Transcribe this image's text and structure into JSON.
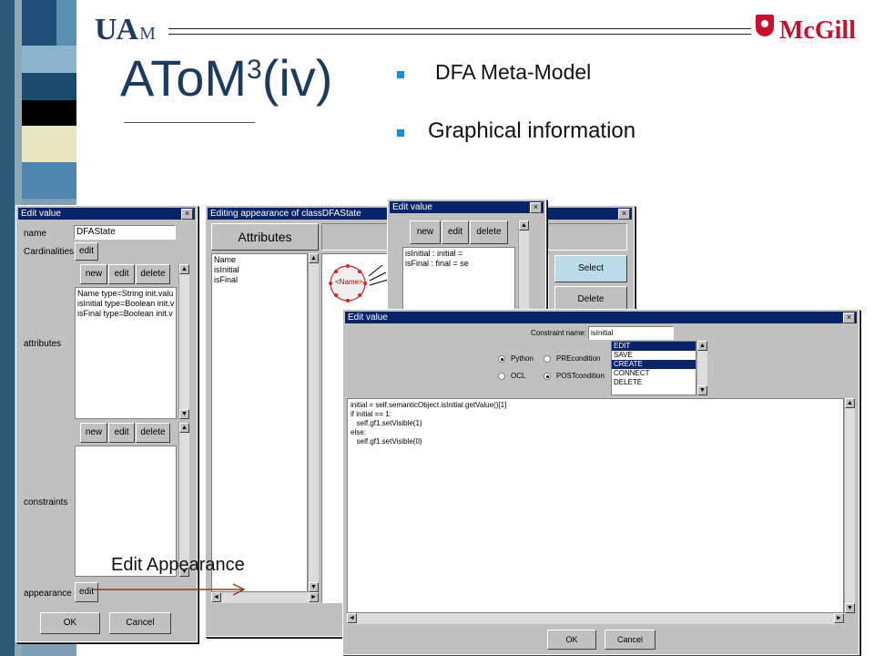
{
  "header": {
    "logo_left": "UA",
    "logo_left_sub": "M",
    "logo_right": "McGill",
    "title": "AToM",
    "title_sup": "3",
    "title_suffix": "(iv)"
  },
  "bullets": [
    "DFA Meta-Model",
    "Graphical information"
  ],
  "colors": {
    "title": "#1d3b5c",
    "bullet": "#1b91c7",
    "titlebar": "#0a246a",
    "arrow": "#8b3a14",
    "mcgill": "#c8102e"
  },
  "edit_value_1": {
    "title": "Edit value",
    "name_label": "name",
    "name_value": "DFAState",
    "cardinalities_label": "Cardinalities",
    "edit": "edit",
    "new": "new",
    "delete": "delete",
    "attributes_label": "attributes",
    "attributes": [
      "Name type=String init.valu",
      "isInitial type=Boolean init.v",
      "isFinal type=Boolean init.v"
    ],
    "constraints_label": "constraints",
    "appearance_label": "appearance",
    "ok": "OK",
    "cancel": "Cancel"
  },
  "appearance_window": {
    "title": "Editing appearance of classDFAState",
    "attributes_header": "Attributes",
    "attributes": [
      "Name",
      "isInitial",
      "isFinal"
    ],
    "node_label": "<Name>",
    "select": "Select",
    "delete": "Delete"
  },
  "edit_value_2": {
    "title": "Edit value",
    "new": "new",
    "edit": "edit",
    "delete": "delete",
    "items": [
      "isInitial : initial =",
      "isFinal : final = se"
    ]
  },
  "edit_value_3": {
    "title": "Edit value",
    "constraint_name_label": "Constraint name:",
    "constraint_name": "isInitial",
    "python": "Python",
    "ocl": "OCL",
    "precondition": "PREcondition",
    "postcondition": "POSTcondition",
    "events": [
      "EDIT",
      "SAVE",
      "CREATE",
      "CONNECT",
      "DELETE"
    ],
    "code": [
      "initial = self.semanticObject.isInitial.getValue()[1]",
      "if initial == 1:",
      "   self.gf1.setVisible(1)",
      "else:",
      "   self.gf1.setVisible(0)"
    ],
    "ok": "OK",
    "cancel": "Cancel"
  },
  "annotation": "Edit Appearance"
}
